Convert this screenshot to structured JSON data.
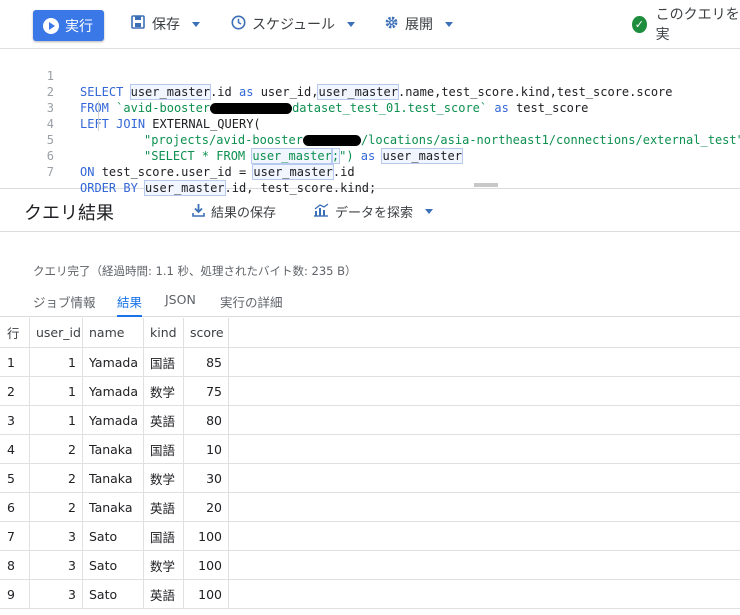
{
  "toolbar": {
    "run_label": "実行",
    "save_label": "保存",
    "schedule_label": "スケジュール",
    "deploy_label": "展開",
    "status_label": "このクエリを実"
  },
  "editor": {
    "line_numbers": [
      "1",
      "2",
      "3",
      "4",
      "5",
      "6",
      "7"
    ],
    "lines": {
      "l1": {
        "select": "SELECT",
        "um1": "user_master",
        "p1": ".id",
        "as1": "as",
        "p2": "user_id,",
        "um2": "user_master",
        "p3": ".name,test_score.kind,test_score.score"
      },
      "l2": {
        "from": "FROM",
        "s1": "`avid-booster",
        "s2": "dataset_test_01.test_score`",
        "as": "as",
        "alias": "test_score"
      },
      "l3": {
        "left": "LEFT",
        "join": "JOIN",
        "rest": "EXTERNAL_QUERY("
      },
      "l4": {
        "s1": "\"projects/avid-booster",
        "s2": "/locations/asia-northeast1/connections/external_test\","
      },
      "l5": {
        "s1": "\"SELECT * FROM ",
        "um": "user_master",
        "semi": ";",
        "s2": "\")",
        "as": "as",
        "alias": "user_master"
      },
      "l6": {
        "on": "ON",
        "p1": "test_score.user_id = ",
        "um": "user_master",
        "p2": ".id"
      },
      "l7": {
        "order": "ORDER",
        "by": "BY",
        "um": "user_master",
        "p1": ".id, test_score.kind;"
      }
    }
  },
  "results": {
    "title": "クエリ結果",
    "save_label": "結果の保存",
    "explore_label": "データを探索",
    "status": "クエリ完了（経過時間: 1.1 秒、処理されたバイト数: 235 B）"
  },
  "tabs": [
    {
      "label": "ジョブ情報"
    },
    {
      "label": "結果"
    },
    {
      "label": "JSON"
    },
    {
      "label": "実行の詳細"
    }
  ],
  "table": {
    "columns": [
      "行",
      "user_id",
      "name",
      "kind",
      "score"
    ],
    "rows": [
      [
        "1",
        "1",
        "Yamada",
        "国語",
        "85"
      ],
      [
        "2",
        "1",
        "Yamada",
        "数学",
        "75"
      ],
      [
        "3",
        "1",
        "Yamada",
        "英語",
        "80"
      ],
      [
        "4",
        "2",
        "Tanaka",
        "国語",
        "10"
      ],
      [
        "5",
        "2",
        "Tanaka",
        "数学",
        "30"
      ],
      [
        "6",
        "2",
        "Tanaka",
        "英語",
        "20"
      ],
      [
        "7",
        "3",
        "Sato",
        "国語",
        "100"
      ],
      [
        "8",
        "3",
        "Sato",
        "数学",
        "100"
      ],
      [
        "9",
        "3",
        "Sato",
        "英語",
        "100"
      ]
    ]
  },
  "colors": {
    "accent": "#3b78e7",
    "link": "#1a73e8",
    "success": "#1e8e3e"
  },
  "icons": [
    "play-icon",
    "save-icon",
    "clock-icon",
    "gear-icon",
    "check-circle-icon",
    "download-icon",
    "chart-icon",
    "caret-down-icon"
  ]
}
